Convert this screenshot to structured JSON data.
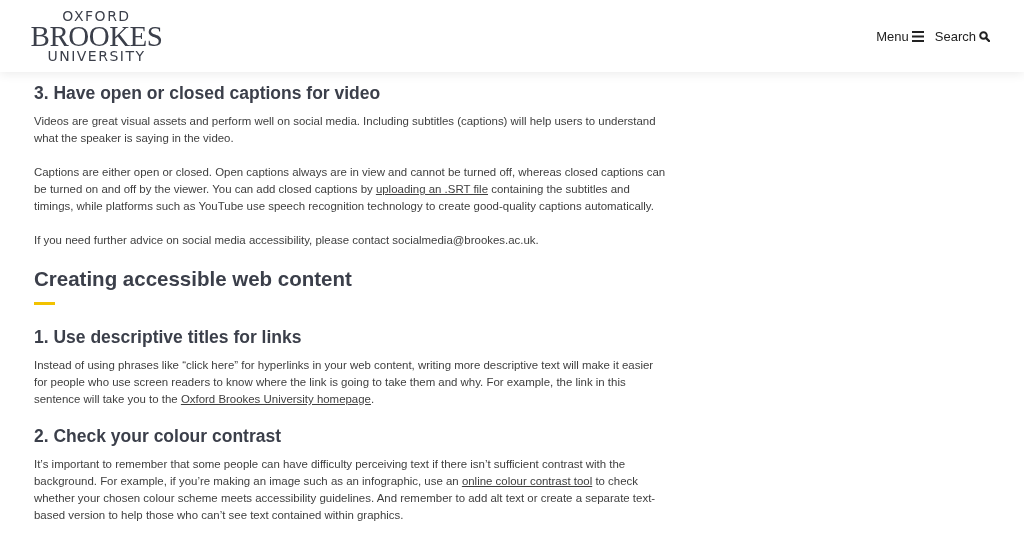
{
  "header": {
    "logo": {
      "top": "OXFORD",
      "middle": "BROOKES",
      "bottom": "UNIVERSITY"
    },
    "nav": [
      {
        "label": "Menu",
        "kind": "menu"
      },
      {
        "label": "Search",
        "kind": "search"
      }
    ]
  },
  "content": [
    {
      "kind": "h3",
      "text": "3. Have open or closed captions for video"
    },
    {
      "kind": "p",
      "text": "Videos are great visual assets and perform well on social media. Including subtitles (captions) will help users to understand what the speaker is saying in the video."
    },
    {
      "kind": "p",
      "before": "Captions are either open or closed. Open captions always are in view and cannot be turned off, whereas closed captions can be turned on and off by the viewer. You can add closed captions by ",
      "link": "uploading an .SRT file",
      "after": " containing the subtitles and timings, while platforms such as YouTube use speech recognition technology to create good-quality captions automatically."
    },
    {
      "kind": "p",
      "text": "If you need further advice on social media accessibility, please contact socialmedia@brookes.ac.uk."
    },
    {
      "kind": "h2",
      "text": "Creating accessible web content"
    },
    {
      "kind": "h3",
      "text": "1. Use descriptive titles for links"
    },
    {
      "kind": "p",
      "before": "Instead of using phrases like “click here” for hyperlinks in your web content, writing more descriptive text will make it easier for people who use screen readers to know where the link is going to take them and why. For example, the link in this sentence will take you to the ",
      "link": "Oxford Brookes University homepage",
      "after": "."
    },
    {
      "kind": "h3",
      "text": "2. Check your colour contrast"
    },
    {
      "kind": "p",
      "before": "It’s important to remember that some people can have difficulty perceiving text if there isn’t sufficient contrast with the background. For example, if you’re making an image such as an infographic, use an ",
      "link": "online colour contrast tool",
      "after": " to check whether your chosen colour scheme meets accessibility guidelines. And remember to add alt text or create a separate text-based version to help those who can’t see text contained within graphics."
    }
  ]
}
